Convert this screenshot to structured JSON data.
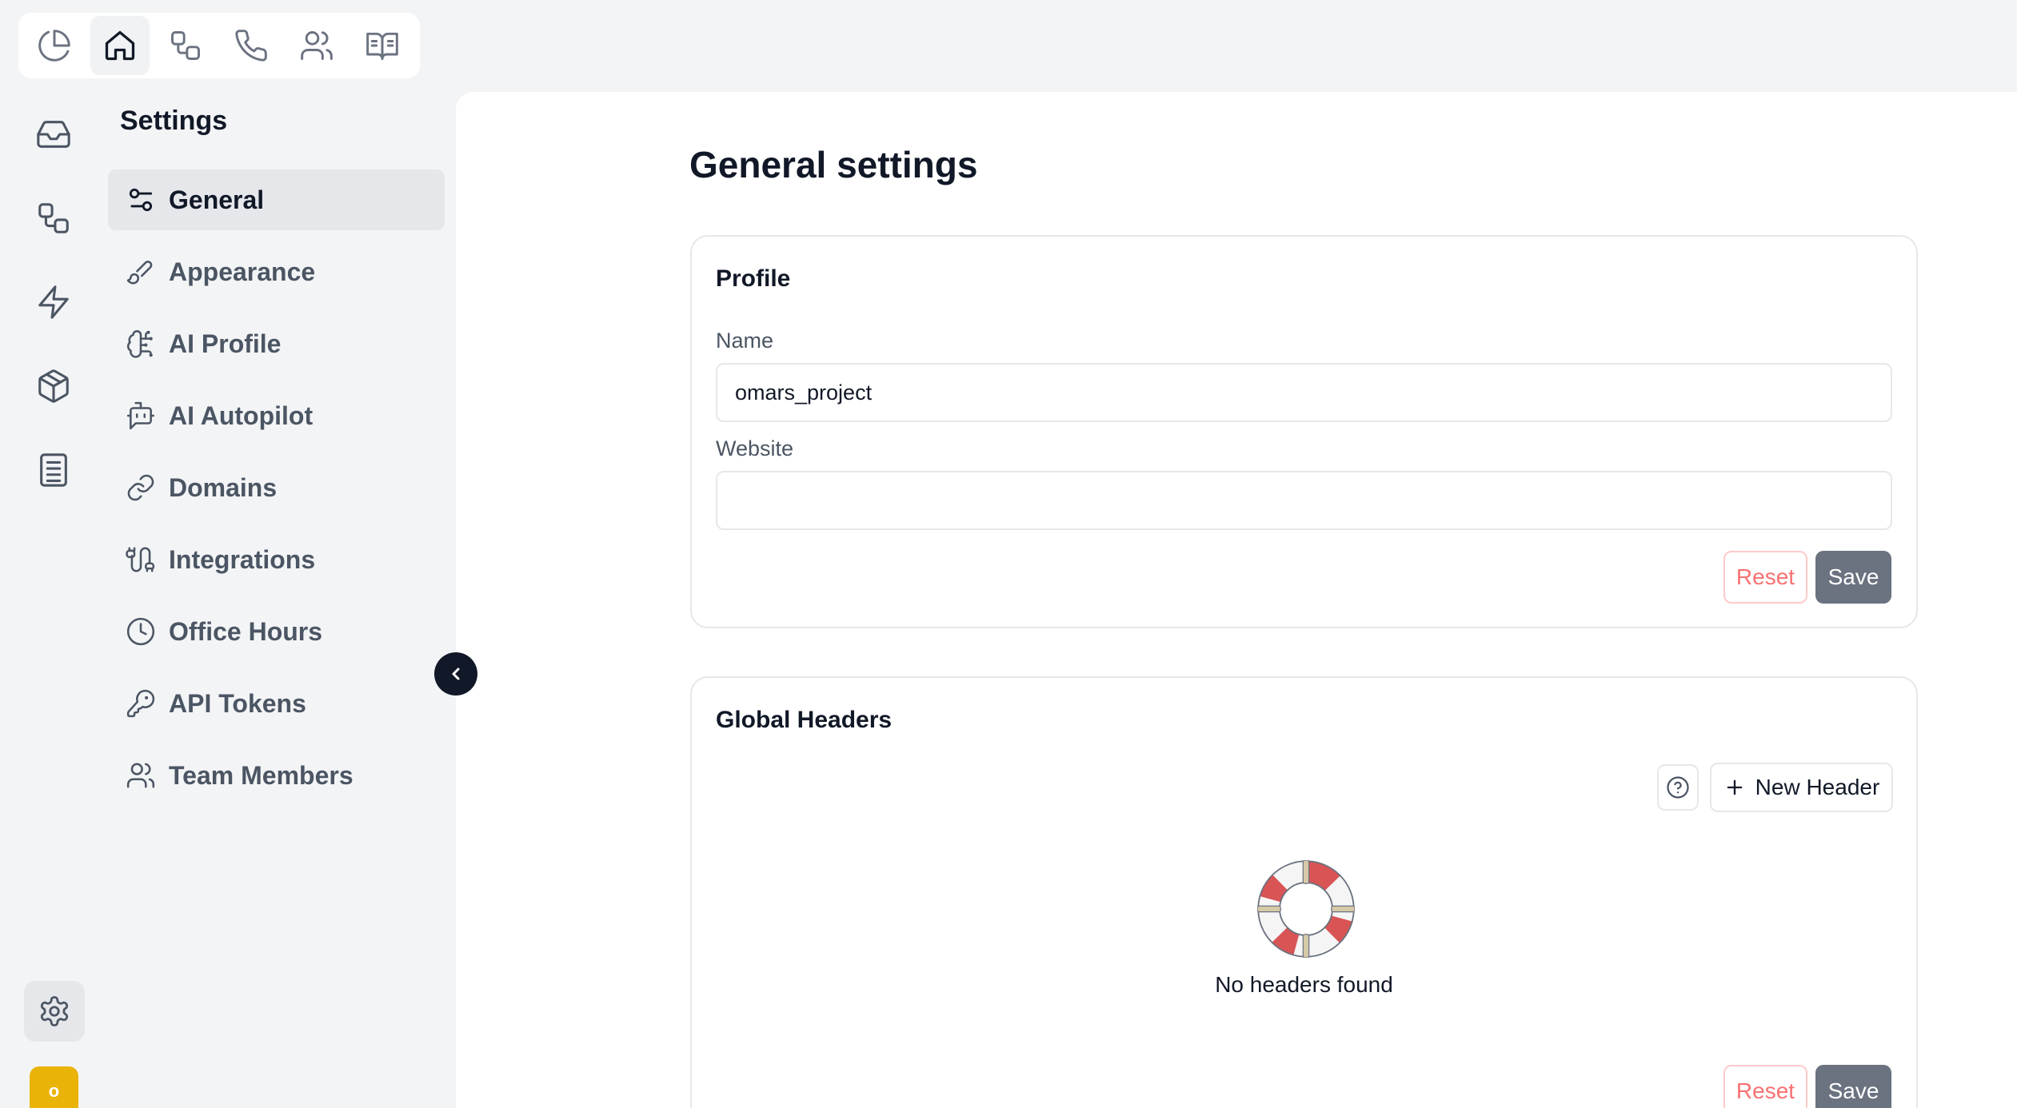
{
  "top_nav": {
    "items": [
      {
        "icon": "pie-chart-icon",
        "active": false
      },
      {
        "icon": "home-icon",
        "active": true
      },
      {
        "icon": "workflow-icon",
        "active": false
      },
      {
        "icon": "phone-icon",
        "active": false
      },
      {
        "icon": "users-icon",
        "active": false
      },
      {
        "icon": "book-open-icon",
        "active": false
      }
    ]
  },
  "rail": {
    "items": [
      "inbox-icon",
      "flows-icon",
      "zap-icon",
      "package-icon",
      "notebook-icon"
    ],
    "settings_icon": "gear-icon",
    "avatar_initial": "o",
    "avatar_color": "#eab308"
  },
  "settings": {
    "title": "Settings",
    "menu": [
      {
        "label": "General",
        "icon": "sliders-icon",
        "active": true
      },
      {
        "label": "Appearance",
        "icon": "brush-icon",
        "active": false
      },
      {
        "label": "AI Profile",
        "icon": "brain-icon",
        "active": false
      },
      {
        "label": "AI Autopilot",
        "icon": "bot-message-icon",
        "active": false
      },
      {
        "label": "Domains",
        "icon": "link-icon",
        "active": false
      },
      {
        "label": "Integrations",
        "icon": "cable-icon",
        "active": false
      },
      {
        "label": "Office Hours",
        "icon": "clock-icon",
        "active": false
      },
      {
        "label": "API Tokens",
        "icon": "key-icon",
        "active": false
      },
      {
        "label": "Team Members",
        "icon": "users-icon",
        "active": false
      }
    ]
  },
  "main": {
    "title": "General settings",
    "profile": {
      "title": "Profile",
      "name_label": "Name",
      "name_value": "omars_project",
      "website_label": "Website",
      "website_value": "",
      "reset_label": "Reset",
      "save_label": "Save"
    },
    "global_headers": {
      "title": "Global Headers",
      "new_header_label": "New Header",
      "empty_text": "No headers found",
      "reset_label": "Reset",
      "save_label": "Save"
    }
  },
  "colors": {
    "accent_dark": "#111827",
    "reset_red": "#f87171",
    "save_gray": "#6b7280",
    "life_ring_red": "#d95454"
  }
}
